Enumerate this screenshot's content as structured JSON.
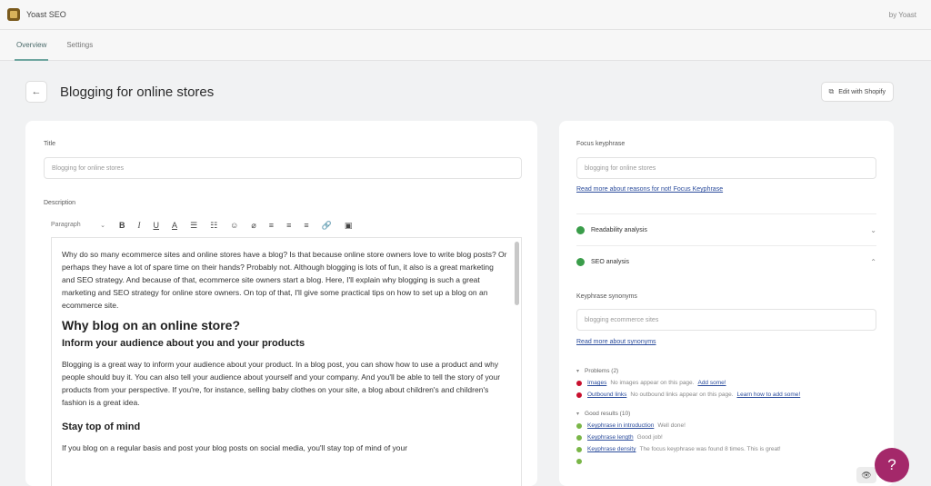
{
  "app": {
    "name": "Yoast SEO",
    "by": "by Yoast"
  },
  "tabs": [
    {
      "label": "Overview",
      "active": true
    },
    {
      "label": "Settings",
      "active": false
    }
  ],
  "header": {
    "back_icon": "arrow-left-icon",
    "title": "Blogging for online stores",
    "edit_button": "Edit with Shopify"
  },
  "left": {
    "title_label": "Title",
    "title_value": "Blogging for online stores",
    "description_label": "Description",
    "toolbar": {
      "format": "Paragraph"
    },
    "content": {
      "intro": "Why do so many ecommerce sites and online stores have a blog? Is that because online store owners love to write blog posts? Or perhaps they have a lot of spare time on their hands? Probably not. Although blogging is lots of fun, it also is a great marketing and SEO strategy. And because of that, ecommerce site owners start a blog. Here, I'll explain why blogging is such a great marketing and SEO strategy for online store owners. On top of that, I'll give some practical tips on how to set up a blog on an ecommerce site.",
      "h2": "Why blog on an online store?",
      "h3a": "Inform your audience about you and your products",
      "p2": "Blogging is a great way to inform your audience about your product. In a blog post, you can show how to use a product and why people should buy it. You can also tell your audience about yourself and your company. And you'll be able to tell the story of your products from your perspective. If you're, for instance, selling baby clothes on your site, a blog about children's and children's fashion is a great idea.",
      "h3b": "Stay top of mind",
      "p3": "If you blog on a regular basis and post your blog posts on social media, you'll stay top of mind of your"
    }
  },
  "right": {
    "focus_label": "Focus keyphrase",
    "focus_value": "blogging for online stores",
    "focus_link": "Read more about reasons for not! Focus Keyphrase",
    "readability": "Readability analysis",
    "seo": "SEO analysis",
    "synonyms_label": "Keyphrase synonyms",
    "synonyms_value": "blogging ecommerce sites",
    "synonyms_link": "Read more about synonyms",
    "problems_head": "Problems (2)",
    "problems": [
      {
        "link": "Images",
        "text": "No images appear on this page.",
        "action": "Add some!"
      },
      {
        "link": "Outbound links",
        "text": "No outbound links appear on this page.",
        "action": "Learn how to add some!"
      }
    ],
    "good_head": "Good results (10)",
    "good": [
      {
        "link": "Keyphrase in introduction",
        "text": "Well done!"
      },
      {
        "link": "Keyphrase length",
        "text": "Good job!"
      },
      {
        "link": "Keyphrase density",
        "text": "The focus keyphrase was found 8 times. This is great!"
      },
      {
        "link": "",
        "text": ""
      }
    ]
  },
  "colors": {
    "accent": "#a4286a",
    "good": "#3a9d4a",
    "problem": "#c8102e",
    "link": "#2b4c9c"
  },
  "help_icon": "?"
}
